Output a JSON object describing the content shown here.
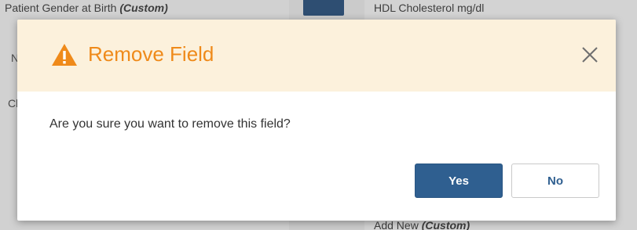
{
  "background": {
    "top_left_field": "Patient Gender at Birth",
    "top_left_custom": "(Custom)",
    "top_right_field": "HDL Cholesterol mg/dl",
    "bottom_right_field": "Add New",
    "bottom_right_custom": "(Custom)",
    "side_letter_1": "N",
    "side_letter_2": "Cl"
  },
  "dialog": {
    "title": "Remove Field",
    "message": "Are you sure you want to remove this field?",
    "yes_label": "Yes",
    "no_label": "No",
    "icons": {
      "warning": "warning-icon",
      "close": "close-icon"
    }
  },
  "colors": {
    "header_bg": "#fcf1dc",
    "title_accent": "#ef8a1a",
    "primary_button": "#2f5f90"
  }
}
